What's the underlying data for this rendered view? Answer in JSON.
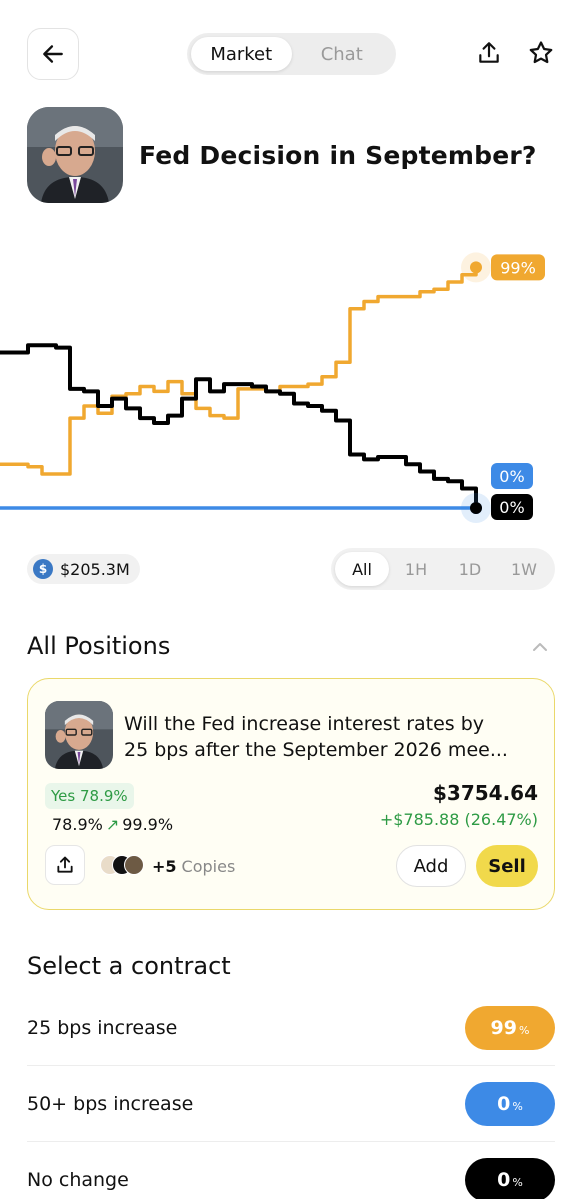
{
  "header": {
    "tabs": [
      {
        "label": "Market",
        "active": true
      },
      {
        "label": "Chat",
        "active": false
      }
    ]
  },
  "market": {
    "title": "Fed Decision in September?"
  },
  "chart_data": {
    "type": "line",
    "series": [
      {
        "color": "#f0a830",
        "end_label": "99%",
        "values": [
          18,
          18,
          17,
          14,
          14,
          37,
          42,
          39,
          46,
          47,
          50,
          48,
          52,
          47,
          41,
          38,
          37,
          49,
          49,
          48,
          50,
          50,
          51,
          54,
          60,
          82,
          85,
          87,
          87,
          87,
          89,
          90,
          93,
          96,
          99
        ]
      },
      {
        "color": "#000000",
        "end_label": "0%",
        "values": [
          64,
          64,
          67,
          67,
          66,
          49,
          48,
          42,
          45,
          41,
          37,
          35,
          38,
          45,
          53,
          48,
          51,
          51,
          50,
          48,
          47,
          43,
          42,
          40,
          36,
          22,
          20,
          21,
          21,
          18,
          15,
          12,
          11,
          8,
          0
        ]
      },
      {
        "color": "#3d8ae6",
        "end_label": "0%",
        "values": [
          0,
          0,
          0,
          0,
          0,
          0,
          0,
          0,
          0,
          0,
          0,
          0,
          0,
          0,
          0,
          0,
          0,
          0,
          0,
          0,
          0,
          0,
          0,
          0,
          0,
          0,
          0,
          0,
          0,
          0,
          0,
          0,
          0,
          0,
          0
        ]
      }
    ],
    "ylim": [
      0,
      100
    ],
    "grid": false
  },
  "stats": {
    "volume": "$205.3M",
    "ranges": [
      {
        "label": "All",
        "active": true
      },
      {
        "label": "1H",
        "active": false
      },
      {
        "label": "1D",
        "active": false
      },
      {
        "label": "1W",
        "active": false
      }
    ]
  },
  "positions": {
    "heading": "All Positions",
    "card": {
      "question_line1": "Will the Fed increase interest rates by",
      "question_line2": "25 bps after the September 2026 mee...",
      "side": "Yes 78.9%",
      "price_from": "78.9%",
      "price_arrow": "↗",
      "price_to": "99.9%",
      "value": "$3754.64",
      "pnl": "+$785.88 (26.47%)",
      "copies_count": "+5",
      "copies_label": "Copies",
      "add_label": "Add",
      "sell_label": "Sell"
    }
  },
  "contracts": {
    "heading": "Select a contract",
    "items": [
      {
        "label": "25 bps increase",
        "value": "99",
        "unit": "%",
        "color": "#f0a830"
      },
      {
        "label": "50+ bps increase",
        "value": "0",
        "unit": "%",
        "color": "#3d8ae6"
      },
      {
        "label": "No change",
        "value": "0",
        "unit": "%",
        "color": "#000000"
      }
    ]
  }
}
